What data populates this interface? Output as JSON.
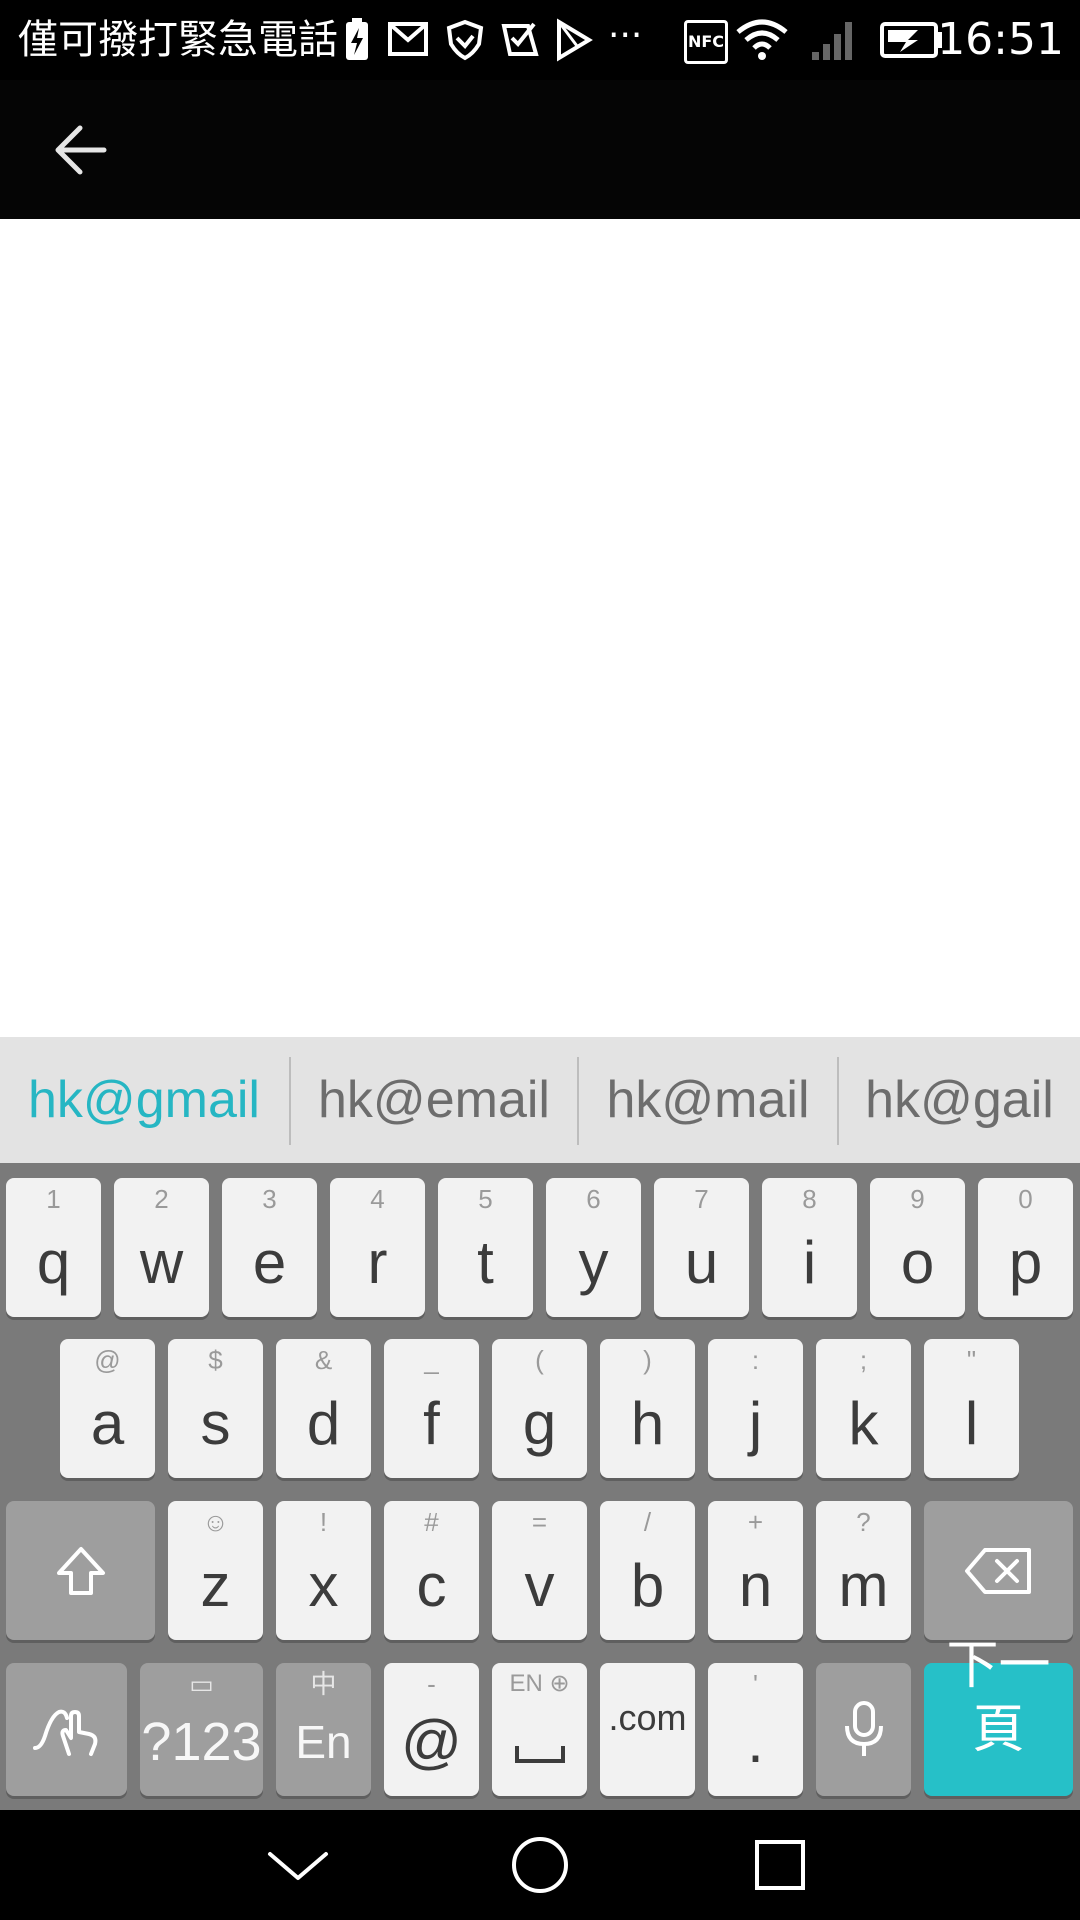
{
  "status_bar": {
    "carrier_text": "僅可撥打緊急電話",
    "nfc_label": "NFC",
    "more": "···",
    "time": "16:51",
    "icons": [
      "battery-charging-icon",
      "gmail-icon",
      "shield-icon",
      "tasks-icon",
      "play-store-icon",
      "nfc-icon",
      "wifi-icon",
      "signal-icon",
      "battery-icon"
    ]
  },
  "app_bar": {
    "back_icon": "arrow-back-icon"
  },
  "suggestions": [
    {
      "text": "hk@gmail",
      "active": true
    },
    {
      "text": "hk@email",
      "active": false
    },
    {
      "text": "hk@mail",
      "active": false
    },
    {
      "text": "hk@gail",
      "active": false
    }
  ],
  "keyboard": {
    "row1": [
      {
        "main": "q",
        "hint": "1"
      },
      {
        "main": "w",
        "hint": "2"
      },
      {
        "main": "e",
        "hint": "3"
      },
      {
        "main": "r",
        "hint": "4"
      },
      {
        "main": "t",
        "hint": "5"
      },
      {
        "main": "y",
        "hint": "6"
      },
      {
        "main": "u",
        "hint": "7"
      },
      {
        "main": "i",
        "hint": "8"
      },
      {
        "main": "o",
        "hint": "9"
      },
      {
        "main": "p",
        "hint": "0"
      }
    ],
    "row2": [
      {
        "main": "a",
        "hint": "@"
      },
      {
        "main": "s",
        "hint": "$"
      },
      {
        "main": "d",
        "hint": "&"
      },
      {
        "main": "f",
        "hint": "_"
      },
      {
        "main": "g",
        "hint": "("
      },
      {
        "main": "h",
        "hint": ")"
      },
      {
        "main": "j",
        "hint": ":"
      },
      {
        "main": "k",
        "hint": ";"
      },
      {
        "main": "l",
        "hint": "\""
      }
    ],
    "row3": [
      {
        "main": "z",
        "hint": "☺"
      },
      {
        "main": "x",
        "hint": "!"
      },
      {
        "main": "c",
        "hint": "#"
      },
      {
        "main": "v",
        "hint": "="
      },
      {
        "main": "b",
        "hint": "/"
      },
      {
        "main": "n",
        "hint": "+"
      },
      {
        "main": "m",
        "hint": "?"
      }
    ],
    "row4": {
      "symbols": {
        "main": "?123",
        "hint": "▭"
      },
      "lang": {
        "main": "En",
        "hint": "中"
      },
      "at": {
        "main": "@",
        "hint": "-"
      },
      "space": {
        "hint": "EN ⊕"
      },
      "dotcom": {
        "main": ".com"
      },
      "period": {
        "main": ".",
        "hint": "'"
      },
      "enter": {
        "main": "下一頁"
      }
    },
    "icons": {
      "shift": "shift-icon",
      "backspace": "backspace-icon",
      "swipe": "swipe-gesture-icon",
      "mic": "microphone-icon",
      "space": "space-icon"
    },
    "colors": {
      "accent": "#26c0c8",
      "suggest_active": "#26b6c3"
    }
  },
  "nav_bar": {
    "icons": [
      "back-chevron-icon",
      "home-circle-icon",
      "recents-square-icon"
    ]
  }
}
